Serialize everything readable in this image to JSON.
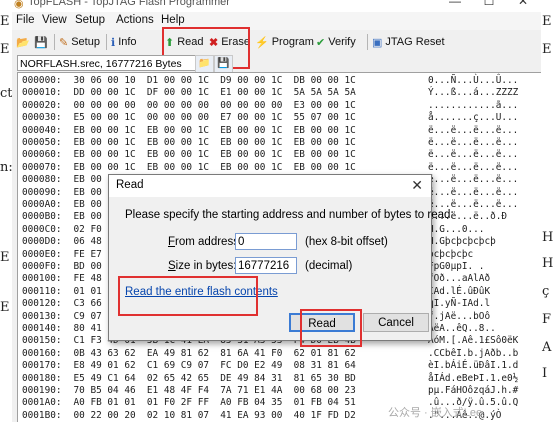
{
  "window": {
    "title": "TopFLASH - TopJTAG Flash Programmer",
    "minimize": "—",
    "maximize": "☐",
    "close": "✕"
  },
  "menu": [
    "File",
    "View",
    "Setup",
    "Actions",
    "Help"
  ],
  "toolbar": {
    "setup": "Setup",
    "info": "Info",
    "read": "Read",
    "erase": "Erase",
    "program": "Program",
    "verify": "Verify",
    "jtag_reset": "JTAG Reset"
  },
  "file_path": "NORFLASH.srec, 16777216 Bytes",
  "hex_rows": [
    {
      "addr": "000000:",
      "bytes": "30 06 00 10  D1 00 00 1C  D9 00 00 1C  DB 00 00 1C",
      "ascii": "0...Ñ...Ù...Û..."
    },
    {
      "addr": "000010:",
      "bytes": "DD 00 00 1C  DF 00 00 1C  E1 00 00 1C  5A 5A 5A 5A",
      "ascii": "Ý...ß...á...ZZZZ"
    },
    {
      "addr": "000020:",
      "bytes": "00 00 00 00  00 00 00 00  00 00 00 00  E3 00 00 1C",
      "ascii": "............ã..."
    },
    {
      "addr": "000030:",
      "bytes": "E5 00 00 1C  00 00 00 00  E7 00 00 1C  55 07 00 1C",
      "ascii": "å.......ç...U..."
    },
    {
      "addr": "000040:",
      "bytes": "EB 00 00 1C  EB 00 00 1C  EB 00 00 1C  EB 00 00 1C",
      "ascii": "ë...ë...ë...ë..."
    },
    {
      "addr": "000050:",
      "bytes": "EB 00 00 1C  EB 00 00 1C  EB 00 00 1C  EB 00 00 1C",
      "ascii": "ë...ë...ë...ë..."
    },
    {
      "addr": "000060:",
      "bytes": "EB 00 00 1C  EB 00 00 1C  EB 00 00 1C  EB 00 00 1C",
      "ascii": "ë...ë...ë...ë..."
    },
    {
      "addr": "000070:",
      "bytes": "EB 00 00 1C  EB 00 00 1C  EB 00 00 1C  EB 00 00 1C",
      "ascii": "ë...ë...ë...ë..."
    },
    {
      "addr": "000080:",
      "bytes": "EB 00",
      "ascii": "ë...ë...ë...ë..."
    },
    {
      "addr": "000090:",
      "bytes": "EB 00",
      "ascii": "ë...ë...ë...ë..."
    },
    {
      "addr": "0000A0:",
      "bytes": "EB 00",
      "ascii": "ë...ë...ë...ë..."
    },
    {
      "addr": "0000B0:",
      "bytes": "EB 00",
      "ascii": "ë...ë...ë..ð.Ð"
    },
    {
      "addr": "0000C0:",
      "bytes": "02 F0",
      "ascii": "H.G...0..."
    },
    {
      "addr": "0000D0:",
      "bytes": "06 48",
      "ascii": "H.Gþcþcþcþcþ"
    },
    {
      "addr": "0000E0:",
      "bytes": "FE E7",
      "ascii": "þcþcþcþc"
    },
    {
      "addr": "0000F0:",
      "bytes": "BD 00",
      "ascii": "FpG0µpI. ."
    },
    {
      "addr": "000100:",
      "bytes": "FE 48",
      "ascii": "fOð...aAlAð"
    },
    {
      "addr": "000110:",
      "bytes": "01 01",
      "ascii": "IAd.lÉ.ûÐûK"
    },
    {
      "addr": "000120:",
      "bytes": "C3 66",
      "ascii": "qI.yÑ-IAd.l"
    },
    {
      "addr": "000130:",
      "bytes": "C9 07",
      "ascii": "f.jAë...bOô"
    },
    {
      "addr": "000140:",
      "bytes": "80 41",
      "ascii": "AëA..êQ..8.."
    },
    {
      "addr": "000150:",
      "bytes": "C1 F3 4D 01  5B 1C 41 EA  85 31 A3 53  F4 D0 EB 4B",
      "ascii": "ÁóM.[.Aê.1£Sô0ëK"
    },
    {
      "addr": "000160:",
      "bytes": "0B 43 63 62  EA 49 81 62  81 6A 41 F0  62 01 81 62",
      "ascii": ".CCbêI.b.jAðb..b"
    },
    {
      "addr": "000170:",
      "bytes": "E8 49 01 62  C1 69 C9 07  FC D0 E2 49  08 31 81 64",
      "ascii": "èI.bÁiÉ.üÐâI.1.d"
    },
    {
      "addr": "000180:",
      "bytes": "E5 49 C1 64  02 65 42 65  DE 49 84 31  81 65 30 BD",
      "ascii": "åIÁd.eBeÞI.1.e0½"
    },
    {
      "addr": "000190:",
      "bytes": "70 B5 04 46  E1 48 4F F4  7A 71 E1 4A  00 68 00 23",
      "ascii": "pµ.FáHOôzqáJ.h.#"
    },
    {
      "addr": "0001A0:",
      "bytes": "A0 FB 01 01  01 F0 2F FF  A0 FB 04 35  01 FB 04 51",
      "ascii": ".û...ð/ÿ.û.5.û.Q"
    },
    {
      "addr": "0001B0:",
      "bytes": "00 22 00 20  02 10 81 07  41 EA 93 00  40 1F FD D2",
      "ascii": ".\"...Aê..@.ýÒ"
    }
  ],
  "dialog": {
    "title": "Read",
    "close": "✕",
    "prompt": "Please specify the starting address and number of bytes to read:",
    "from_label": "From address:",
    "from_value": "0",
    "from_note": "(hex 8-bit offset)",
    "size_label": "Size in bytes:",
    "size_value": "16777216",
    "size_note": "(decimal)",
    "link": "Read the entire flash contents",
    "read_button": "Read",
    "cancel_button": "Cancel"
  },
  "background": {
    "left_fragments": [
      "E",
      "E",
      "cti",
      "n:",
      "E",
      "E"
    ],
    "right_fragments": [
      "E",
      "E",
      "H",
      "H",
      "ç",
      "F",
      "A",
      "I"
    ]
  },
  "watermark": "公众号 · 嵌入式Lee",
  "colors": {
    "highlight": "#e03030",
    "link": "#0645ad",
    "focus": "#3b7bd4"
  }
}
